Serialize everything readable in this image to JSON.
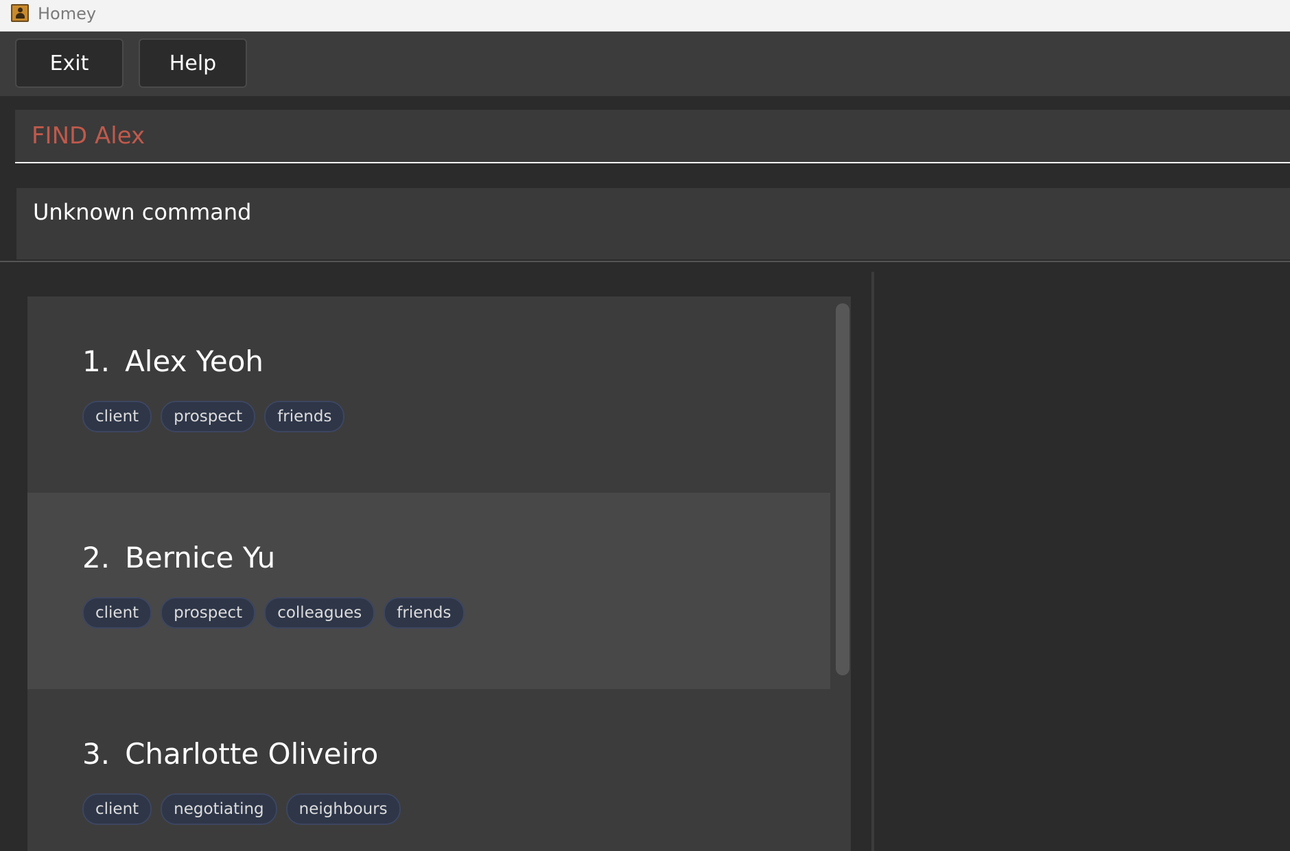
{
  "app": {
    "title": "Homey",
    "icon": "contacts-book-icon"
  },
  "menu": {
    "exit_label": "Exit",
    "help_label": "Help"
  },
  "command": {
    "value": "FIND Alex",
    "text_color": "#c0594b"
  },
  "result": {
    "message": "Unknown command"
  },
  "persons": [
    {
      "index": "1.",
      "name": "Alex Yeoh",
      "tags": [
        "client",
        "prospect",
        "friends"
      ]
    },
    {
      "index": "2.",
      "name": "Bernice Yu",
      "tags": [
        "client",
        "prospect",
        "colleagues",
        "friends"
      ]
    },
    {
      "index": "3.",
      "name": "Charlotte Oliveiro",
      "tags": [
        "client",
        "negotiating",
        "neighbours"
      ]
    }
  ],
  "colors": {
    "background": "#2b2b2b",
    "panel": "#3c3c3c",
    "selected_card": "#484848",
    "tag_bg": "#2e3648"
  }
}
